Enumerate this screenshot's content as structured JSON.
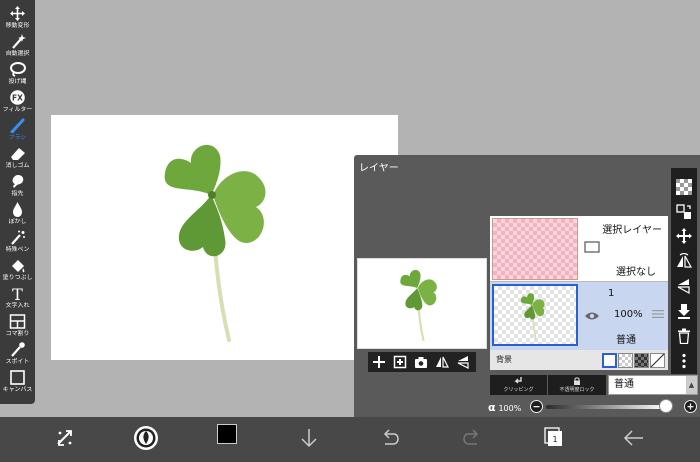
{
  "toolbar": {
    "tools": [
      {
        "label": "移動変形",
        "icon": "move-icon"
      },
      {
        "label": "自動選択",
        "icon": "magic-wand-icon"
      },
      {
        "label": "投げ縄",
        "icon": "lasso-icon"
      },
      {
        "label": "フィルター",
        "icon": "fx-icon",
        "glyph": "FX"
      },
      {
        "label": "ブラシ",
        "icon": "brush-icon",
        "active": true
      },
      {
        "label": "消しゴム",
        "icon": "eraser-icon"
      },
      {
        "label": "指先",
        "icon": "smudge-icon"
      },
      {
        "label": "ぼかし",
        "icon": "blur-drop-icon"
      },
      {
        "label": "特殊ペン",
        "icon": "special-pen-icon"
      },
      {
        "label": "塗りつぶし",
        "icon": "fill-bucket-icon"
      },
      {
        "label": "文字入れ",
        "icon": "text-icon",
        "glyph": "T"
      },
      {
        "label": "コマ割り",
        "icon": "frame-divider-icon"
      },
      {
        "label": "スポイト",
        "icon": "eyedropper-icon"
      },
      {
        "label": "キャンバス",
        "icon": "canvas-icon"
      }
    ],
    "active_color": "#3c8ef3"
  },
  "layer_panel": {
    "title": "レイヤー",
    "selection_layer": {
      "name": "選択レイヤー",
      "status": "選択なし"
    },
    "layer1": {
      "number": "1",
      "opacity": "100%",
      "blend": "普通"
    },
    "background": {
      "label": "背景"
    },
    "buttons": {
      "clipping": "クリッピング",
      "alpha_lock": "不透明度ロック"
    },
    "blend_mode": {
      "selected": "普通"
    },
    "alpha": {
      "symbol": "α",
      "value": "100%",
      "level_percent": 100
    }
  },
  "colors": {
    "primary_color": "#000000",
    "selected_layer_bg": "#c8d6ef",
    "selected_border": "#2a5fd6",
    "panel_bg": "#5a5a5a",
    "toolbar_bg": "#3b3b3b"
  }
}
